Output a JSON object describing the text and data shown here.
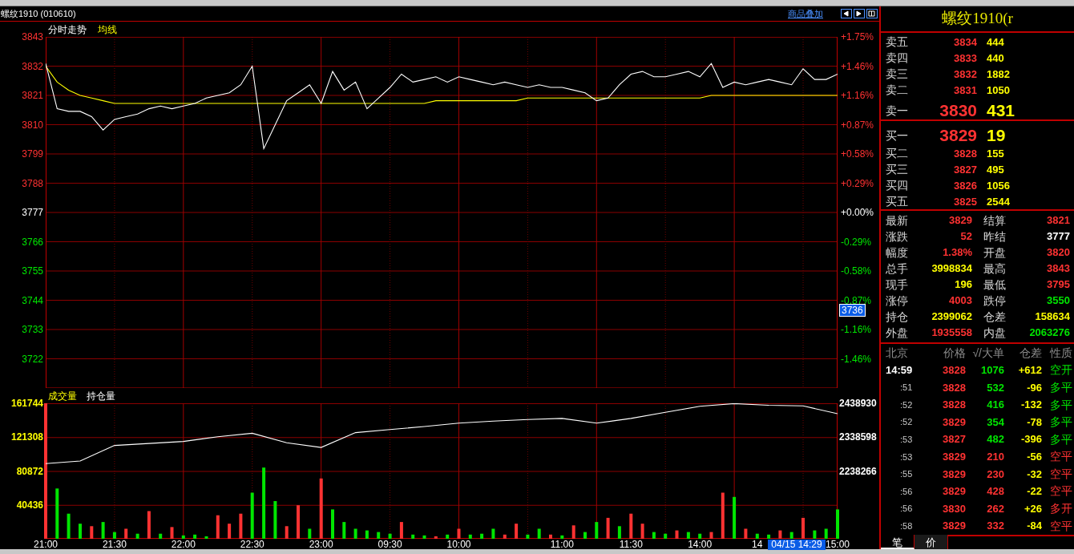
{
  "title_bar": {
    "title": "螺纹1910 (010610)",
    "link": "商品叠加"
  },
  "price_chart": {
    "percent_axis": [
      {
        "label": "+1.75%",
        "color": "#ff3232"
      },
      {
        "label": "+1.46%",
        "color": "#ff3232"
      },
      {
        "label": "+1.16%",
        "color": "#ff3232"
      },
      {
        "label": "+0.87%",
        "color": "#ff3232"
      },
      {
        "label": "+0.58%",
        "color": "#ff3232"
      },
      {
        "label": "+0.29%",
        "color": "#ff3232"
      },
      {
        "label": "+0.00%",
        "color": "#ffffff"
      },
      {
        "label": "-0.29%",
        "color": "#00e600"
      },
      {
        "label": "-0.58%",
        "color": "#00e600"
      },
      {
        "label": "-0.87%",
        "color": "#00e600"
      },
      {
        "label": "-1.16%",
        "color": "#00e600"
      },
      {
        "label": "-1.46%",
        "color": "#00e600"
      }
    ],
    "cursor_price": "3736",
    "chart_data": {
      "type": "line",
      "grid": true,
      "ylim": [
        3711,
        3843
      ],
      "yticks": [
        {
          "value": 3843,
          "label": "3843"
        },
        {
          "value": 3832,
          "label": "3832"
        },
        {
          "value": 3821,
          "label": "3821"
        },
        {
          "value": 3810,
          "label": "3810"
        },
        {
          "value": 3799,
          "label": "3799"
        },
        {
          "value": 3788,
          "label": "3788"
        },
        {
          "value": 3777,
          "label": "3777"
        },
        {
          "value": 3766,
          "label": "3766"
        },
        {
          "value": 3755,
          "label": "3755"
        },
        {
          "value": 3744,
          "label": "3744"
        },
        {
          "value": 3733,
          "label": "3733"
        },
        {
          "value": 3722,
          "label": "3722"
        }
      ],
      "categories": [
        null,
        null,
        null,
        null,
        null,
        null,
        null,
        null,
        null,
        null,
        null,
        null,
        null,
        null,
        null,
        null,
        null,
        null,
        null,
        null,
        null,
        null,
        null,
        null,
        null,
        null,
        null,
        null,
        null,
        null,
        null,
        null,
        null,
        null,
        null,
        null,
        null,
        null,
        null,
        null,
        null,
        null,
        null,
        null,
        null,
        null,
        null,
        null,
        null,
        null,
        null,
        null,
        null,
        null,
        null,
        null,
        null,
        null,
        null,
        null,
        null,
        null,
        null,
        null,
        null,
        null,
        null,
        null,
        null,
        null
      ],
      "series": [
        {
          "name": "分时走势",
          "color": "#ffffff",
          "values": [
            3833,
            3816,
            3815,
            3815,
            3813,
            3808,
            3812,
            3813,
            3814,
            3816,
            3817,
            3816,
            3817,
            3818,
            3820,
            3821,
            3822,
            3825,
            3832,
            3801,
            3810,
            3819,
            3822,
            3825,
            3818,
            3830,
            3823,
            3826,
            3816,
            3820,
            3824,
            3829,
            3826,
            3827,
            3828,
            3826,
            3828,
            3827,
            3826,
            3825,
            3826,
            3825,
            3824,
            3825,
            3824,
            3824,
            3823,
            3822,
            3819,
            3820,
            3825,
            3829,
            3830,
            3828,
            3828,
            3829,
            3830,
            3828,
            3833,
            3824,
            3826,
            3825,
            3826,
            3827,
            3826,
            3825,
            3831,
            3827,
            3827,
            3829
          ]
        },
        {
          "name": "均线",
          "color": "#ffff00",
          "values": [
            3832,
            3826,
            3823,
            3821,
            3820,
            3819,
            3818,
            3818,
            3818,
            3818,
            3818,
            3818,
            3818,
            3818,
            3818,
            3818,
            3818,
            3818,
            3818,
            3818,
            3818,
            3818,
            3818,
            3818,
            3818,
            3818,
            3818,
            3818,
            3818,
            3818,
            3818,
            3818,
            3818,
            3818,
            3819,
            3819,
            3819,
            3819,
            3819,
            3819,
            3819,
            3819,
            3820,
            3820,
            3820,
            3820,
            3820,
            3820,
            3820,
            3820,
            3820,
            3820,
            3820,
            3820,
            3820,
            3820,
            3820,
            3820,
            3821,
            3821,
            3821,
            3821,
            3821,
            3821,
            3821,
            3821,
            3821,
            3821,
            3821,
            3821
          ]
        }
      ]
    }
  },
  "volume_chart": {
    "legend": {
      "label": "成交量"
    },
    "chart_data": {
      "type": "bar",
      "stacked": true,
      "grid": true,
      "ylim": [
        0,
        161744
      ],
      "yticks": [
        {
          "value": 161744,
          "label": "161744"
        },
        {
          "value": 121308,
          "label": "121308"
        },
        {
          "value": 80872,
          "label": "80872"
        },
        {
          "value": 40436,
          "label": "40436"
        }
      ],
      "categories": [
        "21:00",
        null,
        null,
        null,
        null,
        null,
        "21:30",
        null,
        null,
        null,
        null,
        null,
        "22:00",
        null,
        null,
        null,
        null,
        null,
        "22:30",
        null,
        null,
        null,
        null,
        null,
        "23:00",
        null,
        null,
        null,
        null,
        null,
        "09:30",
        null,
        null,
        null,
        null,
        null,
        "10:00",
        null,
        null,
        null,
        null,
        null,
        null,
        null,
        null,
        "11:00",
        null,
        null,
        null,
        null,
        null,
        "11:30",
        null,
        null,
        null,
        null,
        null,
        "14:00",
        null,
        null,
        null,
        null,
        "14",
        null,
        null,
        null,
        null,
        null,
        null,
        "15:00"
      ],
      "series": [
        {
          "color": "#ff3232",
          "values": [
            161744,
            null,
            null,
            null,
            15000,
            null,
            null,
            12000,
            null,
            33000,
            null,
            14000,
            null,
            null,
            null,
            28000,
            18000,
            30000,
            null,
            null,
            null,
            15000,
            40000,
            null,
            72000,
            null,
            null,
            null,
            null,
            null,
            null,
            20000,
            null,
            null,
            3000,
            null,
            12000,
            null,
            null,
            null,
            5000,
            18000,
            null,
            null,
            5000,
            null,
            16000,
            null,
            null,
            25000,
            null,
            30000,
            18000,
            null,
            null,
            10000,
            null,
            null,
            8000,
            55000,
            null,
            12000,
            null,
            null,
            10000,
            null,
            25000,
            null,
            null,
            null
          ]
        },
        {
          "color": "#00e600",
          "values": [
            null,
            60000,
            30000,
            18000,
            null,
            20000,
            8000,
            null,
            6000,
            null,
            6000,
            null,
            4000,
            5000,
            3000,
            null,
            null,
            null,
            55000,
            85000,
            45000,
            null,
            null,
            12000,
            null,
            35000,
            20000,
            12000,
            10000,
            8000,
            6000,
            null,
            5000,
            4000,
            null,
            5000,
            null,
            5000,
            6000,
            12000,
            null,
            null,
            5000,
            12000,
            null,
            4000,
            null,
            8000,
            20000,
            null,
            15000,
            null,
            null,
            8000,
            6000,
            null,
            8000,
            6000,
            null,
            null,
            50000,
            null,
            6000,
            5000,
            null,
            8000,
            null,
            10000,
            12000,
            35000
          ]
        }
      ]
    },
    "cursor_time": "04/15 14:29"
  },
  "open_interest_chart": {
    "chart_data": {
      "type": "line",
      "grid": true,
      "ylim": [
        2037602,
        2438930
      ],
      "yticks": [
        {
          "value": 2438930,
          "label": "2438930"
        },
        {
          "value": 2338598,
          "label": "2338598"
        },
        {
          "value": 2238266,
          "label": "2238266"
        }
      ],
      "categories": [
        null,
        null,
        null,
        null,
        null,
        null,
        null,
        null,
        null,
        null,
        null,
        null,
        null,
        null,
        null,
        null,
        null,
        null,
        null,
        null,
        null,
        null,
        null,
        null
      ],
      "series": [
        {
          "name": "持仓量",
          "color": "#ffffff",
          "values": [
            2260000,
            2268000,
            2314000,
            2320000,
            2326000,
            2340000,
            2350000,
            2322000,
            2308000,
            2352000,
            2361000,
            2370000,
            2380000,
            2386000,
            2391000,
            2394000,
            2380000,
            2394000,
            2412000,
            2430000,
            2438000,
            2433000,
            2431000,
            2408000
          ]
        }
      ]
    }
  },
  "quote_panel": {
    "title": "螺纹1910(r",
    "asks": [
      {
        "label": "卖五",
        "price": "3834",
        "volume": "444",
        "kind": "level"
      },
      {
        "label": "卖四",
        "price": "3833",
        "volume": "440",
        "kind": "level"
      },
      {
        "label": "卖三",
        "price": "3832",
        "volume": "1882",
        "kind": "level"
      },
      {
        "label": "卖二",
        "price": "3831",
        "volume": "1050",
        "kind": "level"
      },
      {
        "label": "卖一",
        "price": "3830",
        "volume": "431",
        "kind": "best"
      }
    ],
    "bids": [
      {
        "label": "买一",
        "price": "3829",
        "volume": "19",
        "kind": "best"
      },
      {
        "label": "买二",
        "price": "3828",
        "volume": "155",
        "kind": "level"
      },
      {
        "label": "买三",
        "price": "3827",
        "volume": "495",
        "kind": "level"
      },
      {
        "label": "买四",
        "price": "3826",
        "volume": "1056",
        "kind": "level"
      },
      {
        "label": "买五",
        "price": "3825",
        "volume": "2544",
        "kind": "level"
      }
    ],
    "stats": [
      {
        "label": "最新",
        "value": "3829",
        "color": "#ff3232"
      },
      {
        "label": "结算",
        "value": "3821",
        "color": "#ff3232"
      },
      {
        "label": "涨跌",
        "value": "52",
        "color": "#ff3232"
      },
      {
        "label": "昨结",
        "value": "3777",
        "color": "#ffffff"
      },
      {
        "label": "幅度",
        "value": "1.38%",
        "color": "#ff3232"
      },
      {
        "label": "开盘",
        "value": "3820",
        "color": "#ff3232"
      },
      {
        "label": "总手",
        "value": "3998834",
        "color": "#ffff00"
      },
      {
        "label": "最高",
        "value": "3843",
        "color": "#ff3232"
      },
      {
        "label": "现手",
        "value": "196",
        "color": "#ffff00"
      },
      {
        "label": "最低",
        "value": "3795",
        "color": "#ff3232"
      },
      {
        "label": "涨停",
        "value": "4003",
        "color": "#ff3232"
      },
      {
        "label": "跌停",
        "value": "3550",
        "color": "#00e600"
      },
      {
        "label": "持仓",
        "value": "2399062",
        "color": "#ffff00"
      },
      {
        "label": "仓差",
        "value": "158634",
        "color": "#ffff00"
      },
      {
        "label": "外盘",
        "value": "1935558",
        "color": "#ff3232"
      },
      {
        "label": "内盘",
        "value": "2063276",
        "color": "#00e600"
      }
    ],
    "tick_columns": [
      "北京",
      "价格",
      "√/大单",
      "仓差",
      "性质"
    ],
    "ticks": [
      {
        "time": "14:59",
        "price": "3828",
        "volume": "1076",
        "change": "+612",
        "nature": "空开",
        "color": "#00e600",
        "kind": "full"
      },
      {
        "time": ":51",
        "price": "3828",
        "volume": "532",
        "change": "-96",
        "nature": "多平",
        "color": "#00e600",
        "kind": "short"
      },
      {
        "time": ":52",
        "price": "3828",
        "volume": "416",
        "change": "-132",
        "nature": "多平",
        "color": "#00e600",
        "kind": "short"
      },
      {
        "time": ":52",
        "price": "3829",
        "volume": "354",
        "change": "-78",
        "nature": "多平",
        "color": "#00e600",
        "kind": "short"
      },
      {
        "time": ":53",
        "price": "3827",
        "volume": "482",
        "change": "-396",
        "nature": "多平",
        "color": "#00e600",
        "kind": "short"
      },
      {
        "time": ":53",
        "price": "3829",
        "volume": "210",
        "change": "-56",
        "nature": "空平",
        "color": "#ff3232",
        "kind": "short"
      },
      {
        "time": ":55",
        "price": "3829",
        "volume": "230",
        "change": "-32",
        "nature": "空平",
        "color": "#ff3232",
        "kind": "short"
      },
      {
        "time": ":56",
        "price": "3829",
        "volume": "428",
        "change": "-22",
        "nature": "空平",
        "color": "#ff3232",
        "kind": "short"
      },
      {
        "time": ":56",
        "price": "3830",
        "volume": "262",
        "change": "+26",
        "nature": "多开",
        "color": "#ff3232",
        "kind": "short"
      },
      {
        "time": ":58",
        "price": "3829",
        "volume": "332",
        "change": "-84",
        "nature": "空平",
        "color": "#ff3232",
        "kind": "short"
      }
    ],
    "tabs": [
      {
        "label": "笔",
        "selected": true
      },
      {
        "label": "价",
        "selected": false
      }
    ]
  }
}
